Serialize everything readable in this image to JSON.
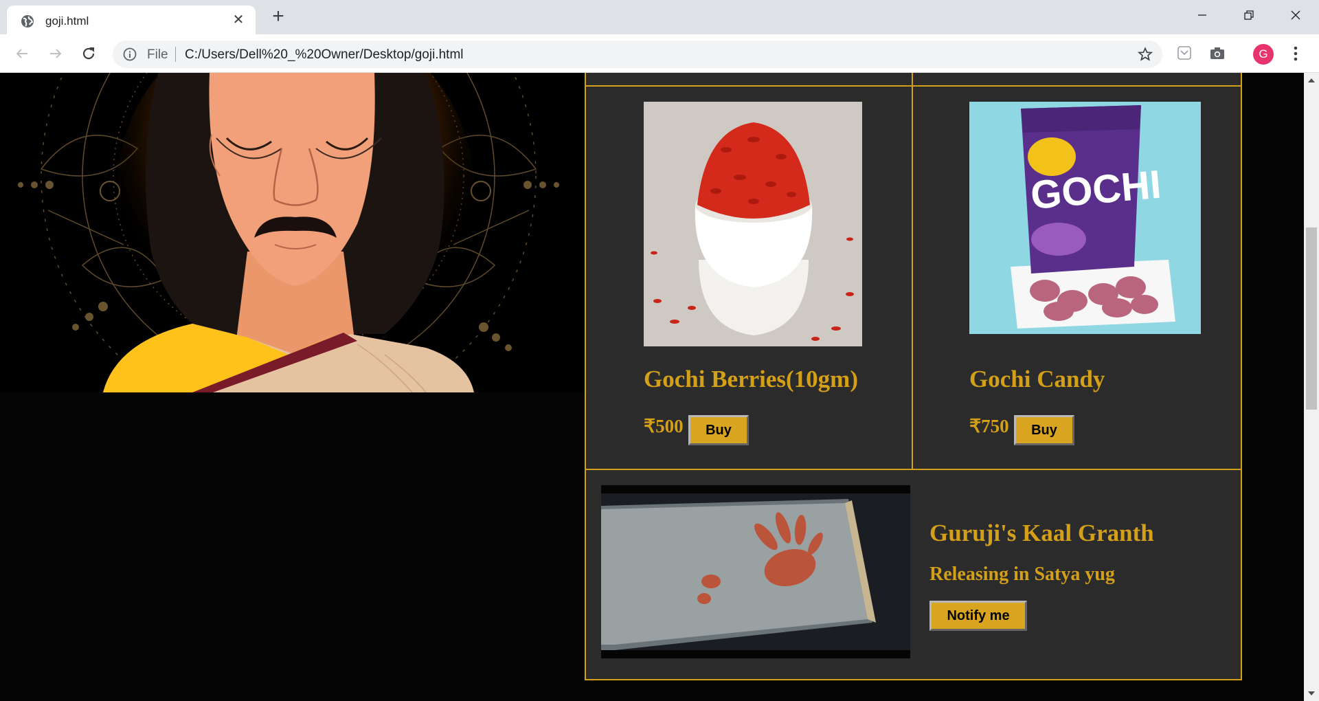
{
  "browser": {
    "tab_title": "goji.html",
    "scheme_label": "File",
    "url": "C:/Users/Dell%20_%20Owner/Desktop/goji.html",
    "profile_initial": "G",
    "profile_color": "#e8336d"
  },
  "colors": {
    "accent_gold": "#d4a017",
    "button_gold": "#d9a520",
    "panel_bg": "#2b2b2b",
    "page_bg": "#050505"
  },
  "hero": {
    "image": "guru-illustration"
  },
  "products": [
    {
      "name": "Gochi Berries(10gm)",
      "price": "₹500",
      "buy_label": "Buy",
      "image": "goji-berries-bowl"
    },
    {
      "name": "Gochi Candy",
      "price": "₹750",
      "buy_label": "Buy",
      "image": "gochi-candy-pack"
    }
  ],
  "featured": {
    "title": "Guruji's Kaal Granth",
    "subtitle": "Releasing in Satya yug",
    "button_label": "Notify me",
    "image": "book-handprint"
  }
}
